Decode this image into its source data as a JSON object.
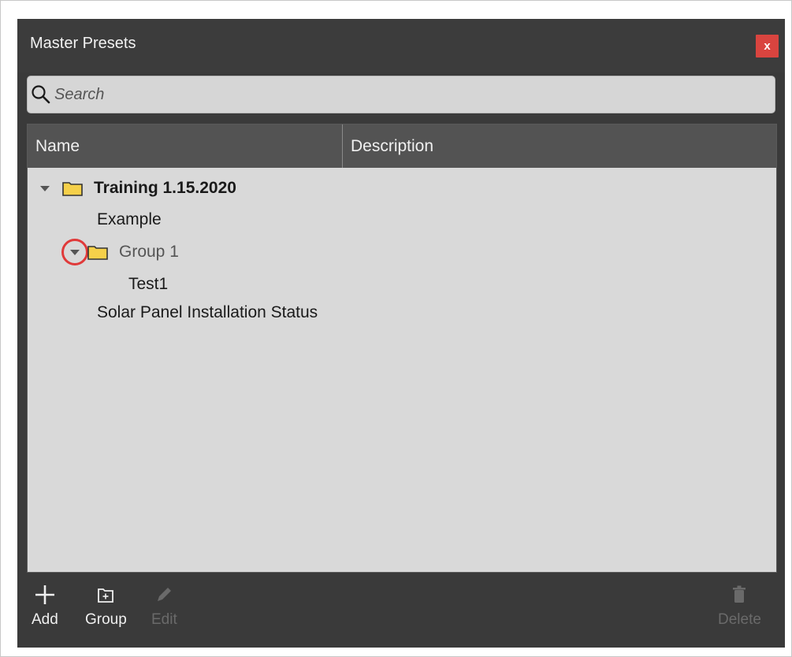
{
  "window": {
    "title": "Master Presets",
    "close_label": "x"
  },
  "search": {
    "placeholder": "Search",
    "value": ""
  },
  "table": {
    "columns": [
      "Name",
      "Description"
    ],
    "rows": [
      {
        "label": "Training 1.15.2020",
        "type": "folder",
        "expanded": true,
        "bold": true
      },
      {
        "label": "Example",
        "type": "item",
        "bold": false
      },
      {
        "label": "Group 1",
        "type": "folder",
        "expanded": true,
        "bold": false
      },
      {
        "label": "Test1",
        "type": "item",
        "bold": false
      },
      {
        "label": "Solar Panel Installation Status",
        "type": "item",
        "bold": false
      }
    ]
  },
  "toolbar": {
    "add_label": "Add",
    "group_label": "Group",
    "edit_label": "Edit",
    "delete_label": "Delete",
    "edit_enabled": false,
    "delete_enabled": false
  },
  "icons": {
    "search": "search-icon",
    "folder": "folder-icon",
    "caret": "caret-down-icon",
    "add": "plus-icon",
    "group": "folder-plus-icon",
    "edit": "pencil-icon",
    "delete": "trash-icon"
  },
  "colors": {
    "window_bg": "#3a3a3a",
    "close_bg": "#d9443f",
    "header_bg": "#535353",
    "list_bg": "#d9d9d9",
    "folder_fill": "#f5d04a",
    "highlight": "#e03a3a"
  }
}
